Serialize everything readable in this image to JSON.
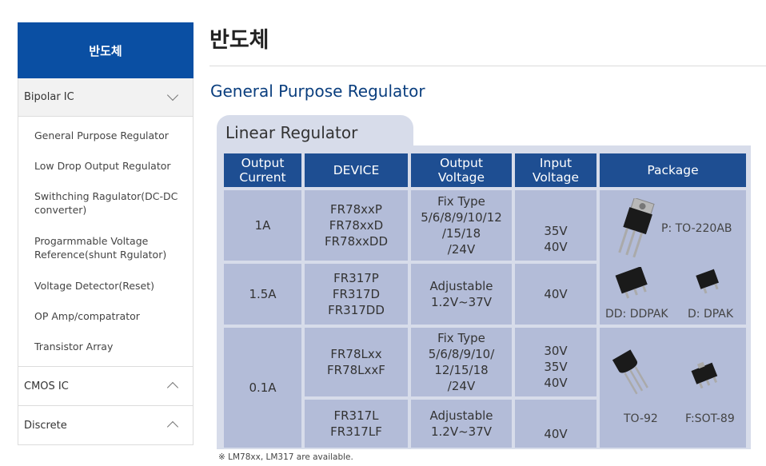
{
  "sidebar": {
    "header": "반도체",
    "categories": [
      {
        "label": "Bipolar IC",
        "expanded": true,
        "items": [
          {
            "label": "General Purpose Regulator"
          },
          {
            "label": "Low Drop Output Regulator"
          },
          {
            "label": "Swithching Ragulator(DC-DC converter)"
          },
          {
            "label": "Progarmmable Voltage Reference(shunt Rgulator)"
          },
          {
            "label": "Voltage Detector(Reset)"
          },
          {
            "label": "OP Amp/compatrator"
          },
          {
            "label": "Transistor Array"
          }
        ]
      },
      {
        "label": "CMOS IC",
        "expanded": false
      },
      {
        "label": "Discrete",
        "expanded": false
      }
    ]
  },
  "main": {
    "title": "반도체",
    "subtitle": "General Purpose Regulator",
    "table_tab": "Linear Regulator",
    "headers": [
      "Output\nCurrent",
      "DEVICE",
      "Output\nVoltage",
      "Input\nVoltage",
      "Package"
    ],
    "rows": [
      {
        "current": "1A",
        "device": "FR78xxP\nFR78xxD\nFR78xxDD",
        "output": "Fix Type\n5/6/8/9/10/12\n/15/18\n/24V",
        "input": "35V\n40V"
      },
      {
        "current": "1.5A",
        "device": "FR317P\nFR317D\nFR317DD",
        "output": "Adjustable\n1.2V~37V",
        "input": "40V"
      },
      {
        "current": "0.1A",
        "device": "FR78Lxx\nFR78LxxF",
        "output": "Fix Type\n5/6/8/9/10/\n12/15/18\n/24V",
        "input": "30V\n35V\n40V"
      },
      {
        "device": "FR317L\nFR317LF",
        "output": "Adjustable\n1.2V~37V",
        "input": "40V"
      }
    ],
    "packages": {
      "to220": "P: TO-220AB",
      "ddpak": "DD: DDPAK",
      "dpak": "D: DPAK",
      "to92": "TO-92",
      "sot89": "F:SOT-89"
    },
    "footnote": "※ LM78xx, LM317 are available."
  },
  "colors": {
    "brand_blue": "#0a4fa3",
    "header_blue": "#1e4e92",
    "cell_bg": "#b3bcd8",
    "panel_bg": "#d7dcea"
  }
}
